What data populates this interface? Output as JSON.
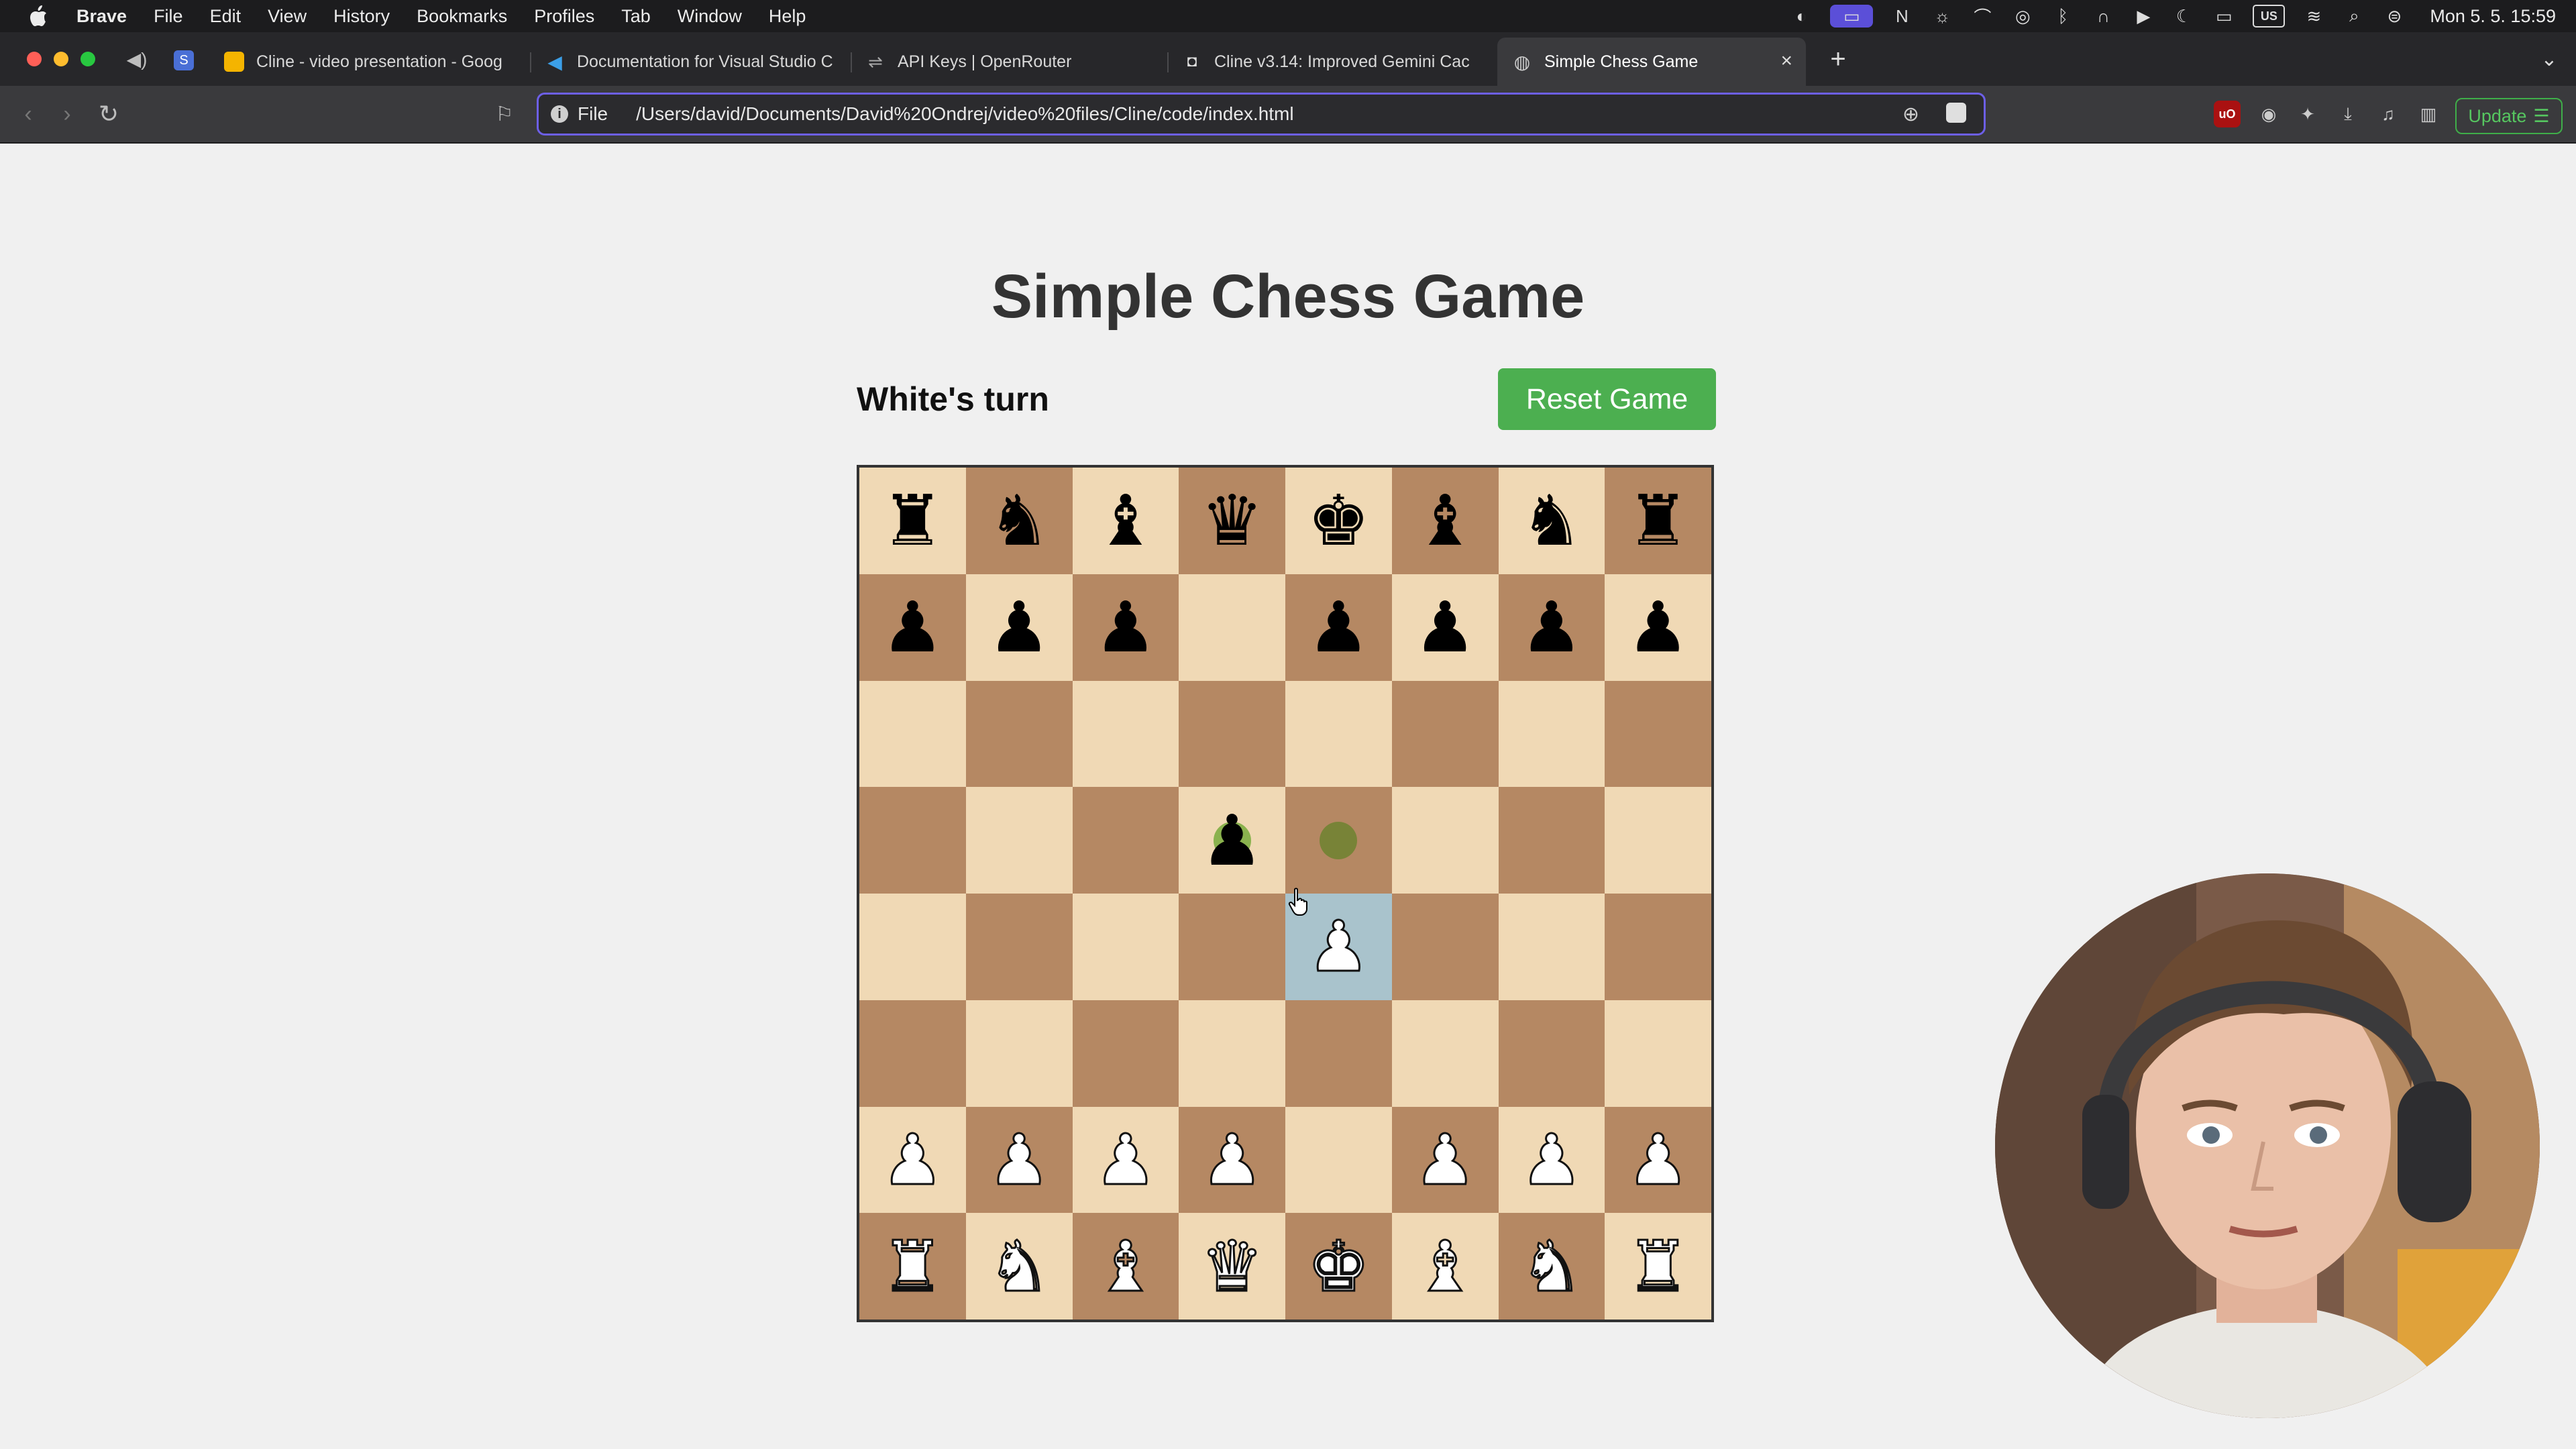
{
  "menubar": {
    "app_name": "Brave",
    "items": [
      "File",
      "Edit",
      "View",
      "History",
      "Bookmarks",
      "Profiles",
      "Tab",
      "Window",
      "Help"
    ],
    "keyboard_layout": "US",
    "clock": "Mon 5. 5.  15:59"
  },
  "tabs": [
    {
      "label": "Cline - video presentation - Goog",
      "favicon": "google-slides-icon"
    },
    {
      "label": "Documentation for Visual Studio C",
      "favicon": "vscode-icon"
    },
    {
      "label": "API Keys | OpenRouter",
      "favicon": "openrouter-icon"
    },
    {
      "label": "Cline v3.14: Improved Gemini Cac",
      "favicon": "cline-icon"
    },
    {
      "label": "Simple Chess Game",
      "favicon": "globe-icon",
      "active": true
    }
  ],
  "address_bar": {
    "scheme": "File",
    "url": "/Users/david/Documents/David%20Ondrej/video%20files/Cline/code/index.html"
  },
  "toolbar": {
    "update_label": "Update"
  },
  "game": {
    "title": "Simple Chess Game",
    "status": "White's turn",
    "reset_label": "Reset Game"
  },
  "board": {
    "light_color": "#f0d9b5",
    "dark_color": "#b58863",
    "selected_color": "#a9c3cc",
    "rows": [
      [
        "bR",
        "bN",
        "bB",
        "bQ",
        "bK",
        "bB",
        "bN",
        "bR"
      ],
      [
        "bP",
        "bP",
        "bP",
        "",
        "bP",
        "bP",
        "bP",
        "bP"
      ],
      [
        "",
        "",
        "",
        "",
        "",
        "",
        "",
        ""
      ],
      [
        "",
        "",
        "",
        "bP",
        "",
        "",
        "",
        ""
      ],
      [
        "",
        "",
        "",
        "",
        "wP",
        "",
        "",
        ""
      ],
      [
        "",
        "",
        "",
        "",
        "",
        "",
        "",
        ""
      ],
      [
        "wP",
        "wP",
        "wP",
        "wP",
        "",
        "wP",
        "wP",
        "wP"
      ],
      [
        "wR",
        "wN",
        "wB",
        "wQ",
        "wK",
        "wB",
        "wN",
        "wR"
      ]
    ],
    "selected": "e4",
    "legal_moves": [
      "e5"
    ],
    "captures": [
      "d5"
    ]
  }
}
